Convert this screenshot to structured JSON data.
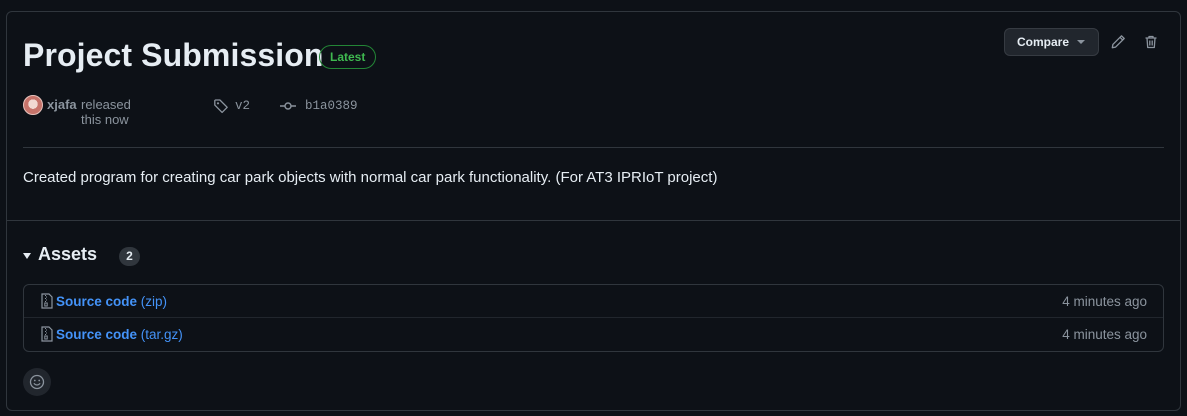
{
  "release": {
    "title": "Project Submission",
    "badge": "Latest",
    "author": "xjafa",
    "released_text": "released this now",
    "tag": "v2",
    "commit": "b1a0389",
    "description": "Created program for creating car park objects with normal car park functionality. (For AT3 IPRIoT project)"
  },
  "actions": {
    "compare_label": "Compare"
  },
  "assets": {
    "label": "Assets",
    "count": "2",
    "items": [
      {
        "name": "Source code",
        "ext": "(zip)",
        "time": "4 minutes ago"
      },
      {
        "name": "Source code",
        "ext": "(tar.gz)",
        "time": "4 minutes ago"
      }
    ]
  },
  "colors": {
    "background": "#0d1117",
    "border": "#30363d",
    "link": "#4493f8",
    "latest": "#3fb950",
    "muted": "#8b949e"
  }
}
